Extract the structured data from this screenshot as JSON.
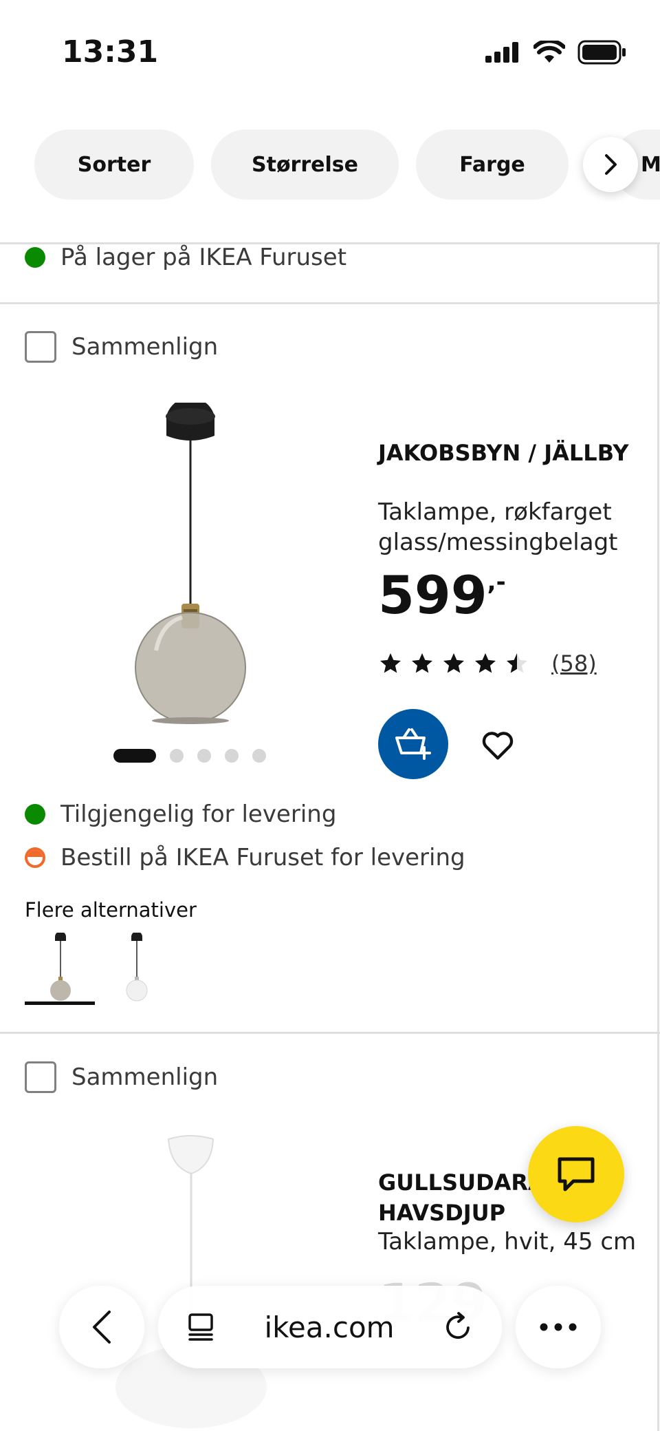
{
  "status_bar": {
    "time": "13:31"
  },
  "filters": {
    "chips": [
      "Sorter",
      "Størrelse",
      "Farge"
    ],
    "partial_chip": "Ma"
  },
  "previous_product": {
    "availability": "På lager på IKEA Furuset"
  },
  "product1": {
    "compare_label": "Sammenlign",
    "name": "JAKOBSBYN / JÄLLBY",
    "description": "Taklampe, røkfarget glass/messingbelagt",
    "price": "599",
    "price_suffix": ",-",
    "rating": {
      "stars": 4.5,
      "max": 5,
      "reviews": "(58)"
    },
    "carousel": {
      "images": 5,
      "active": 1
    },
    "availability": [
      {
        "status": "green",
        "text": "Tilgjengelig for levering"
      },
      {
        "status": "orange",
        "text": "Bestill på IKEA Furuset for levering"
      }
    ],
    "more_options_label": "Flere alternativer",
    "variants": [
      "smoked-glass-lamp",
      "white-glass-lamp"
    ]
  },
  "product2": {
    "compare_label": "Sammenlign",
    "name": "GULLSUDARÅ / HAVSDJUP",
    "description": "Taklampe, hvit, 45 cm"
  },
  "browser": {
    "url": "ikea.com"
  },
  "colors": {
    "ikea_blue": "#0058a3",
    "ikea_yellow": "#fbd914",
    "stock_green": "#0a8a00",
    "warning_orange": "#f26a2a"
  }
}
